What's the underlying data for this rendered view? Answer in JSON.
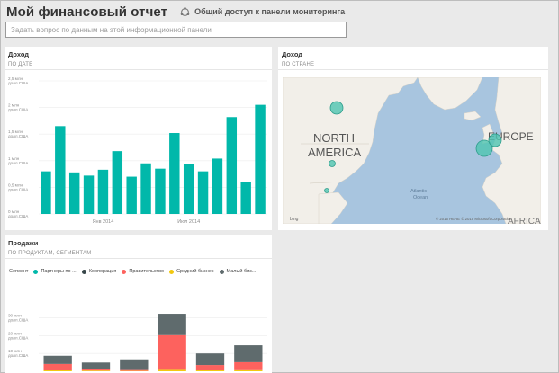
{
  "header": {
    "title": "Мой финансовый отчет",
    "share_label": "Общий доступ к панели мониторинга"
  },
  "qa": {
    "placeholder": "Задать вопрос по данным на этой информационной панели"
  },
  "tiles": {
    "income_by_date": {
      "title": "Доход",
      "subtitle": "ПО ДАТЕ"
    },
    "income_by_country": {
      "title": "Доход",
      "subtitle": "ПО СТРАНЕ"
    },
    "sales": {
      "title": "Продажи",
      "subtitle": "ПО ПРОДУКТАМ, СЕГМЕНТАМ"
    }
  },
  "map": {
    "labels": {
      "north_america": "NORTH\nAMERICA",
      "north": "NORTH",
      "america": "AMERICA",
      "europe": "EUROPE",
      "atlantic": "Atlantic\nOcean",
      "atlantic_1": "Atlantic",
      "atlantic_2": "Ocean",
      "africa": "AFRICA"
    },
    "bing": "bing",
    "copyright": "© 2015 HERE   © 2015 Microsoft Corporation",
    "bubble_color": "#4dc4b0"
  },
  "chart_data": [
    {
      "type": "bar",
      "title": "Доход",
      "subtitle": "ПО ДАТЕ",
      "y_ticks": [
        "2,5 млн\nдолл.США",
        "2 млн\nдолл.США",
        "1,5 млн\nдолл.США",
        "1 млн\nдолл.США",
        "0,5 млн\nдолл.США",
        "0 млн\nдолл.США"
      ],
      "y_tick_lines": [
        [
          "2,5 млн",
          "долл.США"
        ],
        [
          "2 млн",
          "долл.США"
        ],
        [
          "1,5 млн",
          "долл.США"
        ],
        [
          "1 млн",
          "долл.США"
        ],
        [
          "0,5 млн",
          "долл.США"
        ],
        [
          "0 млн",
          "долл.США"
        ]
      ],
      "x_tick_labels": [
        "Янв 2014",
        "Июл 2014"
      ],
      "ylim": [
        0,
        2.5
      ],
      "values": [
        0.8,
        1.65,
        0.78,
        0.72,
        0.83,
        1.18,
        0.7,
        0.95,
        0.85,
        1.52,
        0.93,
        0.8,
        1.04,
        1.82,
        0.6,
        2.05
      ],
      "color": "#01b8aa",
      "grid": true
    },
    {
      "type": "bar",
      "title": "Продажи",
      "subtitle": "ПО ПРОДУКТАМ, СЕГМЕНТАМ",
      "legend_title": "Сегмент",
      "legend": [
        {
          "name": "Партнеры по ...",
          "color": "#01b8aa"
        },
        {
          "name": "Корпорация",
          "color": "#374649"
        },
        {
          "name": "Правительство",
          "color": "#fd625e"
        },
        {
          "name": "Средний бизнес",
          "color": "#f2c80f"
        },
        {
          "name": "Малый биз...",
          "color": "#5f6b6d"
        }
      ],
      "y_ticks": [
        "30 млн\nдолл.США",
        "20 млн\nдолл.США",
        "10 млн\nдолл.США"
      ],
      "y_tick_lines": [
        [
          "30 млн",
          "долл.США"
        ],
        [
          "20 млн",
          "долл.США"
        ],
        [
          "10 млн",
          "долл.США"
        ]
      ],
      "stacks": [
        {
          "segments": [
            0.5,
            3.6,
            4.6
          ]
        },
        {
          "segments": [
            0.4,
            0.9,
            3.6
          ]
        },
        {
          "segments": [
            0.2,
            0.5,
            6.0
          ]
        },
        {
          "segments": [
            0.8,
            19.5,
            12.0
          ]
        },
        {
          "segments": [
            0.5,
            3.0,
            6.5
          ]
        },
        {
          "segments": [
            0.6,
            4.5,
            9.5
          ]
        }
      ],
      "stack_colors": [
        "#f2c80f",
        "#fd625e",
        "#5f6b6d"
      ]
    }
  ]
}
